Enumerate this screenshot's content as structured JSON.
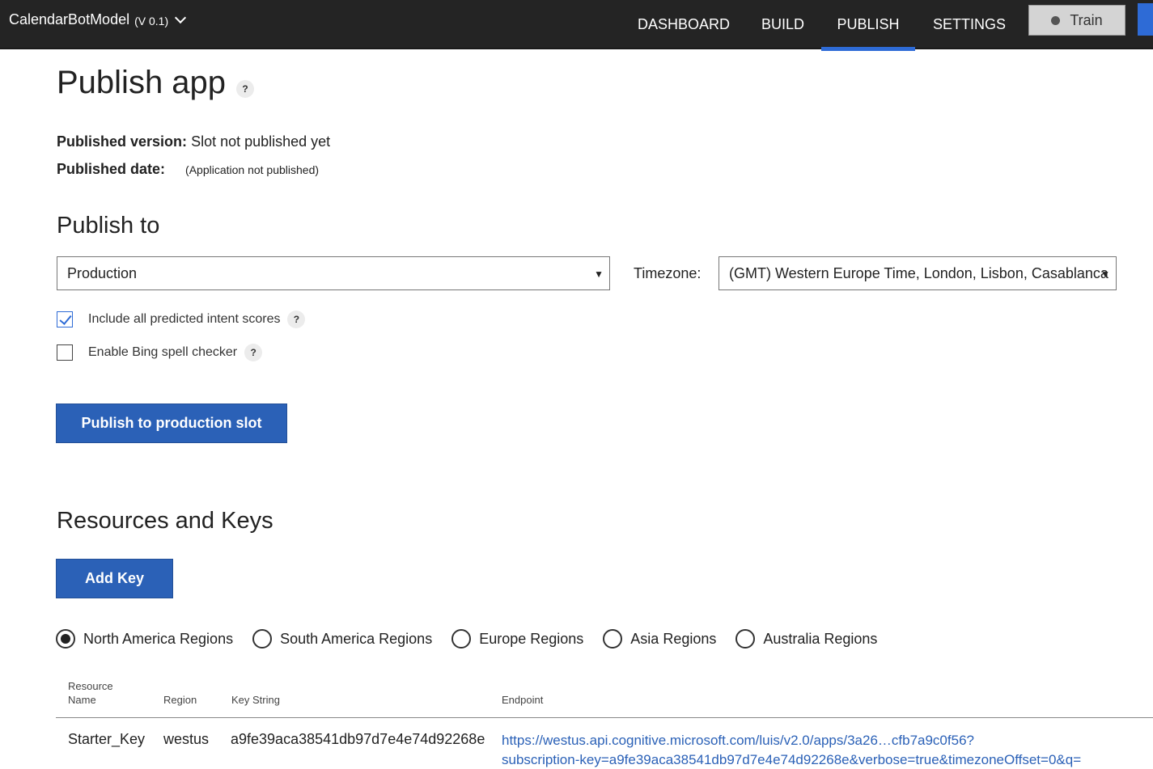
{
  "header": {
    "app_name": "CalendarBotModel",
    "version": "(V 0.1)",
    "nav": [
      "DASHBOARD",
      "BUILD",
      "PUBLISH",
      "SETTINGS"
    ],
    "active_nav": "PUBLISH",
    "train_label": "Train"
  },
  "page": {
    "title": "Publish app",
    "help": "?",
    "published_version_label": "Published version:",
    "published_version_value": "Slot not published yet",
    "published_date_label": "Published date:",
    "published_date_value": "(Application not published)"
  },
  "publish_to": {
    "heading": "Publish to",
    "slot_selected": "Production",
    "timezone_label": "Timezone:",
    "timezone_selected": "(GMT) Western Europe Time, London, Lisbon, Casablanca",
    "options": [
      {
        "label": "Include all predicted intent scores",
        "checked": true
      },
      {
        "label": "Enable Bing spell checker",
        "checked": false
      }
    ],
    "publish_button": "Publish to production slot"
  },
  "resources": {
    "heading": "Resources and Keys",
    "add_key_button": "Add Key",
    "regions": [
      "North America Regions",
      "South America Regions",
      "Europe Regions",
      "Asia Regions",
      "Australia Regions"
    ],
    "selected_region": "North America Regions",
    "table": {
      "headers": [
        "Resource Name",
        "Region",
        "Key String",
        "Endpoint"
      ],
      "rows": [
        {
          "resource_name": "Starter_Key",
          "region": "westus",
          "key_string": "a9fe39aca38541db97d7e4e74d92268e",
          "endpoint_line1": "https://westus.api.cognitive.microsoft.com/luis/v2.0/apps/3a26…cfb7a9c0f56?",
          "endpoint_line2": "subscription-key=a9fe39aca38541db97d7e4e74d92268e&verbose=true&timezoneOffset=0&q="
        }
      ]
    }
  }
}
